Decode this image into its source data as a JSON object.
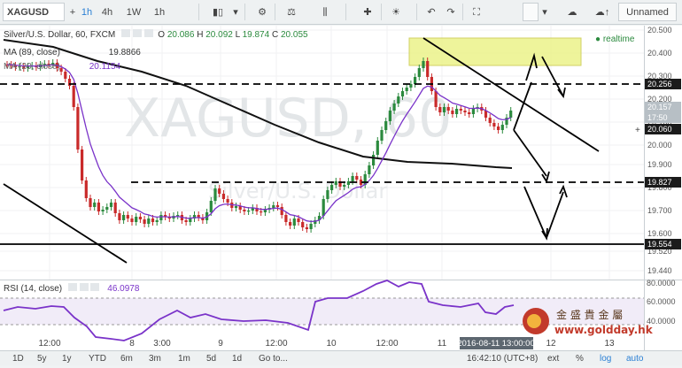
{
  "toolbar": {
    "symbol": "XAGUSD",
    "intervals": [
      "1h",
      "4h",
      "1W",
      "1h"
    ],
    "active_interval": "1h",
    "layout_button": "Unnamed"
  },
  "chart_header": {
    "title": "Silver/U.S. Dollar, 60, FXCM",
    "ohlc": [
      "O",
      "20.086",
      "H",
      "20.092",
      "L",
      "19.874",
      "C",
      "20.055"
    ],
    "realtime": "realtime",
    "ma_label": "MA (89, close)",
    "ma_value": "19.8866",
    "ma2_label": "MA (20, close)",
    "ma2_value": "20.1154",
    "watermark_symbol": "XAGUSD, 60",
    "watermark_name": "Silver/U.S. Dollar"
  },
  "price_axis": {
    "ticks": [
      "20.500",
      "20.400",
      "20.300",
      "20.200",
      "20.100",
      "20.000",
      "19.900",
      "19.800",
      "19.700",
      "19.600",
      "19.520",
      "19.440"
    ],
    "labels": [
      {
        "text": "20.256",
        "style": "dark"
      },
      {
        "text": "20.157",
        "style": "light"
      },
      {
        "text": "17:50",
        "style": "light"
      },
      {
        "text": "20.060",
        "style": "dark"
      },
      {
        "text": "19.827",
        "style": "dark"
      },
      {
        "text": "19.554",
        "style": "dark"
      }
    ]
  },
  "rsi": {
    "label": "RSI (14, close)",
    "value": "46.0978",
    "ticks": [
      "80.0000",
      "60.0000",
      "40.0000"
    ]
  },
  "time_axis": {
    "ticks": [
      "12:00",
      "8",
      "3:00",
      "9",
      "12:00",
      "10",
      "12:00",
      "11",
      "12",
      "13"
    ],
    "cursor_label": "2016-08-11 13:00:00"
  },
  "bottom_bar": {
    "ranges": [
      "1D",
      "5y",
      "1y",
      "YTD",
      "6m",
      "3m",
      "1m",
      "5d",
      "1d",
      "Go to..."
    ],
    "clock": "16:42:10 (UTC+8)",
    "options": [
      "ext",
      "%",
      "log",
      "auto"
    ]
  },
  "watermark_logo": {
    "chinese": "金 盛 貴 金 屬",
    "url": "www.goldday.hk"
  },
  "colors": {
    "candle_up": "#2b8a3e",
    "candle_down": "#c92a2a",
    "ma_fast": "#7a33c9",
    "rsi_line": "#7a33c9",
    "highlight_box": "#ecf38a"
  }
}
